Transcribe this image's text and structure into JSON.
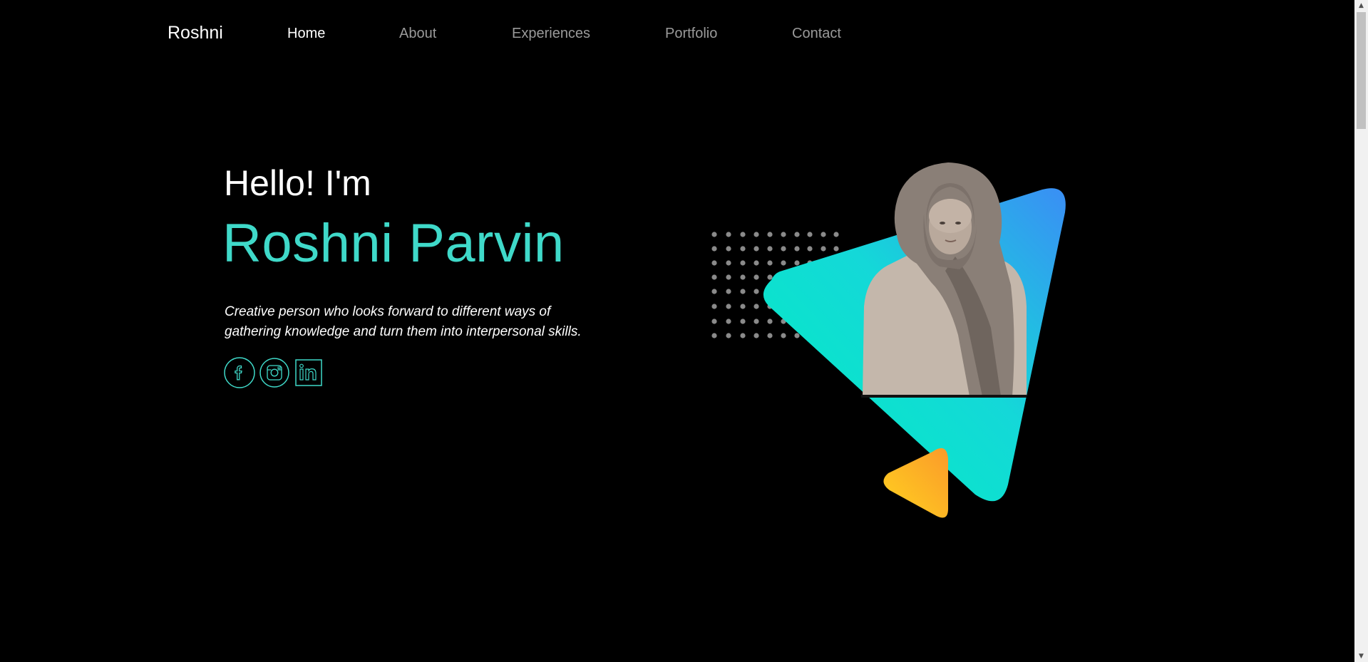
{
  "header": {
    "brand": "Roshni",
    "nav": [
      {
        "label": "Home",
        "active": true
      },
      {
        "label": "About",
        "active": false
      },
      {
        "label": "Experiences",
        "active": false
      },
      {
        "label": "Portfolio",
        "active": false
      },
      {
        "label": "Contact",
        "active": false
      }
    ]
  },
  "hero": {
    "greeting": "Hello! I'm",
    "name": "Roshni Parvin",
    "tagline_line1": "Creative person who looks forward to different ways of",
    "tagline_line2": "gathering knowledge and turn them into interpersonal skills.",
    "socials": [
      {
        "icon": "facebook-icon"
      },
      {
        "icon": "instagram-icon"
      },
      {
        "icon": "linkedin-icon"
      }
    ]
  },
  "colors": {
    "background": "#000000",
    "accent": "#3fd9c9",
    "nav_inactive": "#9a9a9a",
    "triangle_gradient_start": "#00f0c0",
    "triangle_gradient_end": "#3a8ef5",
    "small_triangle_start": "#ffd21f",
    "small_triangle_end": "#fb9a2a",
    "dots": "#8a8a8a"
  },
  "artwork": {
    "portrait": "person-portrait-icon",
    "dot_grid": "dot-grid-icon",
    "large_triangle": "triangle-shape-icon",
    "small_triangle": "triangle-shape-icon"
  }
}
